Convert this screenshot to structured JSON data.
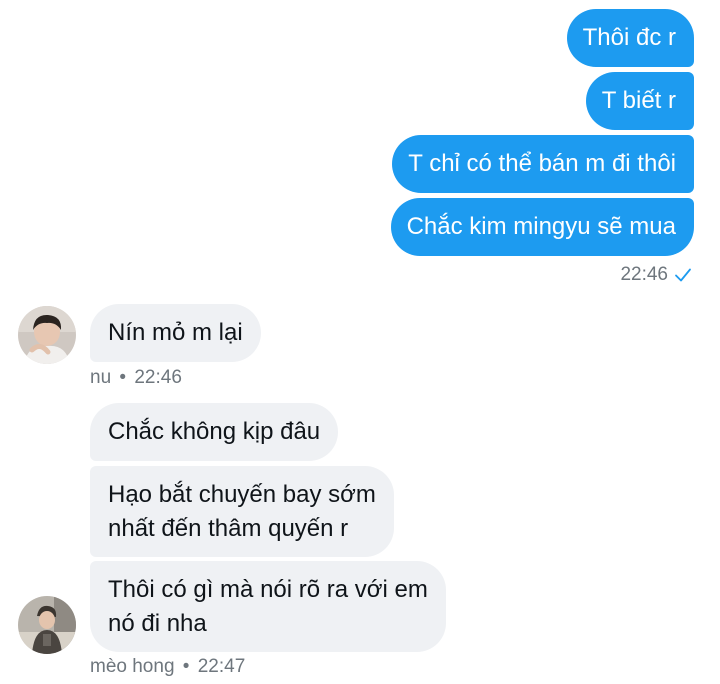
{
  "colors": {
    "sent_bubble": "#1d9bf0",
    "received_bubble": "#eff1f4",
    "meta_text": "#6e767d",
    "read_check": "#1d9bf0"
  },
  "sent": {
    "messages": [
      "Thôi đc r",
      "T biết r",
      "T chỉ có thể bán m đi thôi",
      "Chắc kim mingyu sẽ mua"
    ],
    "time": "22:46",
    "status_icon": "read-check-icon"
  },
  "received_1": {
    "message": "Nín mỏ m lại",
    "sender": "nu",
    "separator": "•",
    "time": "22:46",
    "avatar_icon": "user-avatar-photo"
  },
  "received_2": {
    "messages": [
      "Chắc không kịp đâu",
      [
        "Hạo bắt chuyến bay sớm",
        "nhất đến thâm quyến r"
      ],
      [
        "Thôi có gì mà nói rõ ra với em",
        "nó đi nha"
      ]
    ],
    "sender": "mèo hong",
    "separator": "•",
    "time": "22:47",
    "avatar_icon": "user-avatar-photo"
  }
}
